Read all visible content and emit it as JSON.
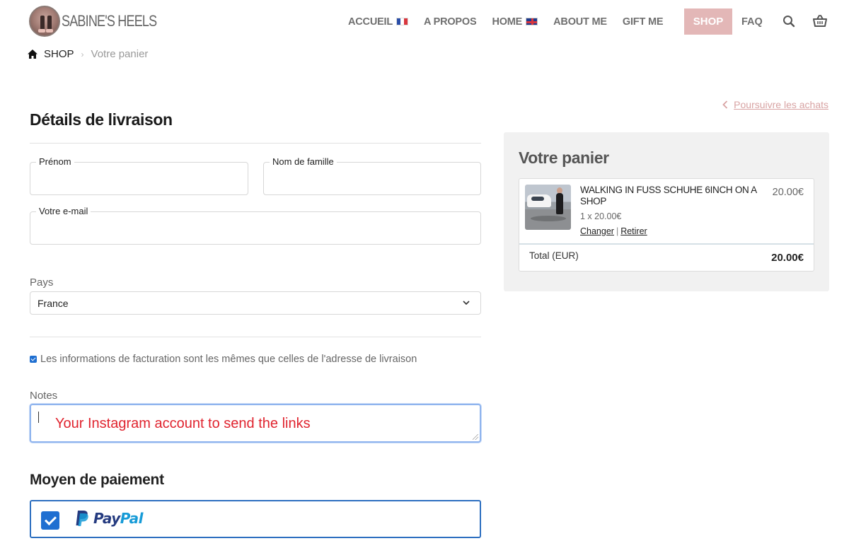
{
  "brand": {
    "name": "SABINE'S HEELS"
  },
  "nav": {
    "items": [
      {
        "label": "ACCUEIL",
        "flag": "fr"
      },
      {
        "label": "A PROPOS"
      },
      {
        "label": "HOME",
        "flag": "uk"
      },
      {
        "label": "ABOUT ME"
      },
      {
        "label": "GIFT ME"
      }
    ],
    "shop_label": "SHOP",
    "faq_label": "FAQ",
    "search_icon": "search-icon",
    "cart_icon": "basket-icon"
  },
  "breadcrumb": {
    "home_label": "SHOP",
    "separator": "›",
    "current": "Votre panier"
  },
  "continue_shopping": "Poursuivre les achats",
  "form": {
    "title": "Détails de livraison",
    "first_name_label": "Prénom",
    "last_name_label": "Nom de famille",
    "email_label": "Votre e-mail",
    "country_label": "Pays",
    "country_value": "France",
    "billing_same_label": "Les informations de facturation sont les mêmes que celles de l'adresse de livraison",
    "billing_same_checked": true,
    "notes_label": "Notes",
    "notes_annotation": "Your Instagram account to send the links",
    "payment_title": "Moyen de paiement",
    "payment_method": {
      "name_part1": "Pay",
      "name_part2": "Pal",
      "checked": true
    }
  },
  "cart": {
    "title": "Votre panier",
    "item": {
      "name": "WALKING IN FUSS SCHUHE 6INCH ON A SHOP",
      "price": "20.00€",
      "quantity": "1 x 20.00€",
      "change_label": "Changer",
      "remove_label": "Retirer",
      "separator": "|"
    },
    "total_label": "Total (EUR)",
    "total_value": "20.00€"
  },
  "colors": {
    "shop_button": "#e3b7b7",
    "link_pink": "#d8a3a3",
    "checkbox_blue": "#1f6fd1",
    "annotation_red": "#e0242f",
    "paypal_dark": "#253b80",
    "paypal_light": "#179bd7"
  }
}
